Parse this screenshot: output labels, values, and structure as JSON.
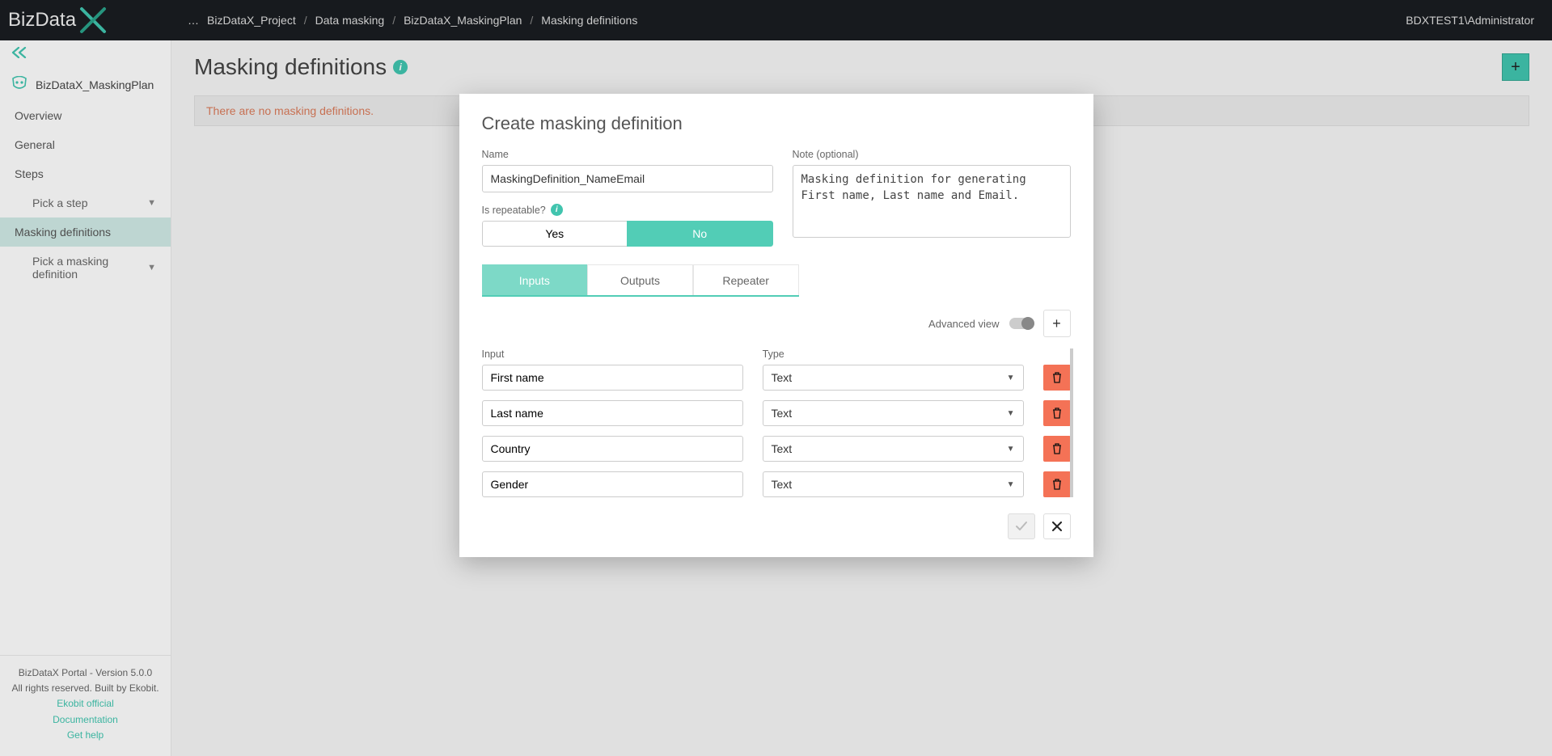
{
  "header": {
    "logo_text_a": "BizData",
    "breadcrumb_prefix": "…",
    "crumbs": [
      "BizDataX_Project",
      "Data masking",
      "BizDataX_MaskingPlan",
      "Masking definitions"
    ],
    "user": "BDXTEST1\\Administrator"
  },
  "sidebar": {
    "plan": "BizDataX_MaskingPlan",
    "items": [
      {
        "label": "Overview"
      },
      {
        "label": "General"
      },
      {
        "label": "Steps"
      },
      {
        "label": "Pick a step",
        "sub": true
      },
      {
        "label": "Masking definitions",
        "active": true
      },
      {
        "label": "Pick a masking definition",
        "sub": true
      }
    ],
    "footer": {
      "line1": "BizDataX Portal - Version 5.0.0",
      "line2": "All rights reserved. Built by Ekobit.",
      "links": [
        "Ekobit official",
        "Documentation",
        "Get help"
      ]
    }
  },
  "page": {
    "title": "Masking definitions",
    "empty_msg": "There are no masking definitions."
  },
  "modal": {
    "title": "Create masking definition",
    "name_label": "Name",
    "name_value": "MaskingDefinition_NameEmail",
    "note_label": "Note (optional)",
    "note_value": "Masking definition for generating First name, Last name and Email.",
    "repeat_label": "Is repeatable?",
    "repeat_yes": "Yes",
    "repeat_no": "No",
    "tabs": {
      "inputs": "Inputs",
      "outputs": "Outputs",
      "repeater": "Repeater"
    },
    "adv_label": "Advanced view",
    "grid_headers": {
      "input": "Input",
      "type": "Type"
    },
    "rows": [
      {
        "input": "First name",
        "type": "Text"
      },
      {
        "input": "Last name",
        "type": "Text"
      },
      {
        "input": "Country",
        "type": "Text"
      },
      {
        "input": "Gender",
        "type": "Text"
      }
    ]
  }
}
